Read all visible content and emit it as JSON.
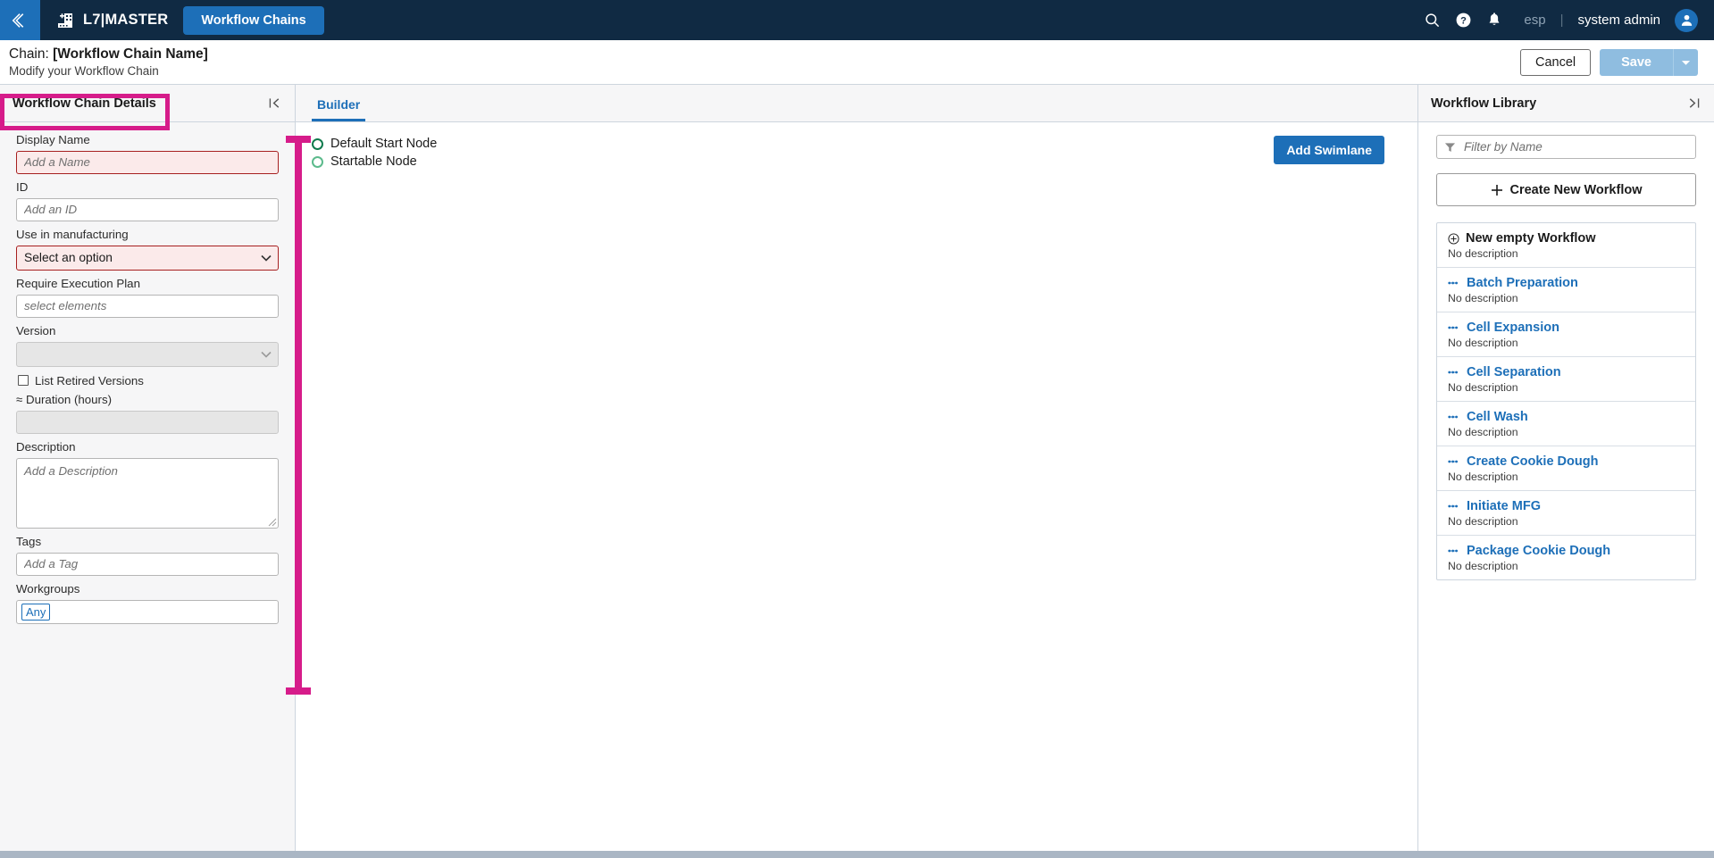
{
  "topnav": {
    "back_icon": "chevron-double-left-icon",
    "brand_icon": "building-plus-icon",
    "brand": "L7|MASTER",
    "active_tab": "Workflow Chains",
    "search_icon": "search-icon",
    "help_icon": "help-circle-icon",
    "notifications_icon": "bell-icon",
    "language": "esp",
    "separator": "|",
    "user": "system admin",
    "avatar_icon": "user-avatar-icon"
  },
  "subheader": {
    "title_prefix": "Chain: ",
    "title_value": "[Workflow Chain Name]",
    "subtitle": "Modify your Workflow Chain",
    "cancel_label": "Cancel",
    "save_label": "Save",
    "save_caret_icon": "caret-down-icon"
  },
  "left_panel": {
    "header": "Workflow Chain Details",
    "collapse_icon": "collapse-left-icon",
    "fields": {
      "display_name": {
        "label": "Display Name",
        "value": "",
        "placeholder": "Add a Name",
        "state": "error"
      },
      "id": {
        "label": "ID",
        "value": "",
        "placeholder": "Add an ID",
        "state": "normal"
      },
      "use_in_manufacturing": {
        "label": "Use in manufacturing",
        "value": "Select an option",
        "state": "error"
      },
      "require_execution_plan": {
        "label": "Require Execution Plan",
        "value": "",
        "placeholder": "select elements",
        "state": "normal"
      },
      "version": {
        "label": "Version",
        "value": "",
        "placeholder": "",
        "state": "disabled"
      },
      "list_retired_versions": {
        "label": "List Retired Versions",
        "checked": false
      },
      "duration": {
        "label": "≈ Duration (hours)",
        "value": "",
        "placeholder": "",
        "state": "disabled"
      },
      "description": {
        "label": "Description",
        "value": "",
        "placeholder": "Add a Description",
        "state": "normal"
      },
      "tags": {
        "label": "Tags",
        "value": "",
        "placeholder": "Add a Tag",
        "state": "normal"
      },
      "workgroups": {
        "label": "Workgroups",
        "chips": [
          "Any"
        ]
      }
    }
  },
  "mid_panel": {
    "tab": "Builder",
    "legend": [
      {
        "label": "Default Start Node",
        "color": "#0f7a4d",
        "icon": "circle-outline-icon"
      },
      {
        "label": "Startable Node",
        "color": "#5cba8c",
        "icon": "circle-outline-icon"
      }
    ],
    "add_swimlane_label": "Add Swimlane"
  },
  "right_panel": {
    "header": "Workflow Library",
    "collapse_icon": "collapse-right-icon",
    "filter": {
      "value": "",
      "placeholder": "Filter by Name",
      "icon": "filter-icon"
    },
    "create_button": {
      "label": "Create New Workflow",
      "icon": "plus-icon"
    },
    "items": [
      {
        "title": "New empty Workflow",
        "description": "No description",
        "icon": "plus-circle-icon",
        "style": "first"
      },
      {
        "title": "Batch Preparation",
        "description": "No description",
        "icon": "workflow-dots-icon",
        "style": "link"
      },
      {
        "title": "Cell Expansion",
        "description": "No description",
        "icon": "workflow-dots-icon",
        "style": "link"
      },
      {
        "title": "Cell Separation",
        "description": "No description",
        "icon": "workflow-dots-icon",
        "style": "link"
      },
      {
        "title": "Cell Wash",
        "description": "No description",
        "icon": "workflow-dots-icon",
        "style": "link"
      },
      {
        "title": "Create Cookie Dough",
        "description": "No description",
        "icon": "workflow-dots-icon",
        "style": "link"
      },
      {
        "title": "Initiate MFG",
        "description": "No description",
        "icon": "workflow-dots-icon",
        "style": "link"
      },
      {
        "title": "Package Cookie Dough",
        "description": "No description",
        "icon": "workflow-dots-icon",
        "style": "link"
      }
    ]
  },
  "annotations": {
    "highlight_color": "#d61c8a",
    "box_target": "Workflow Chain Details",
    "bracket_target": "left panel form fields"
  }
}
